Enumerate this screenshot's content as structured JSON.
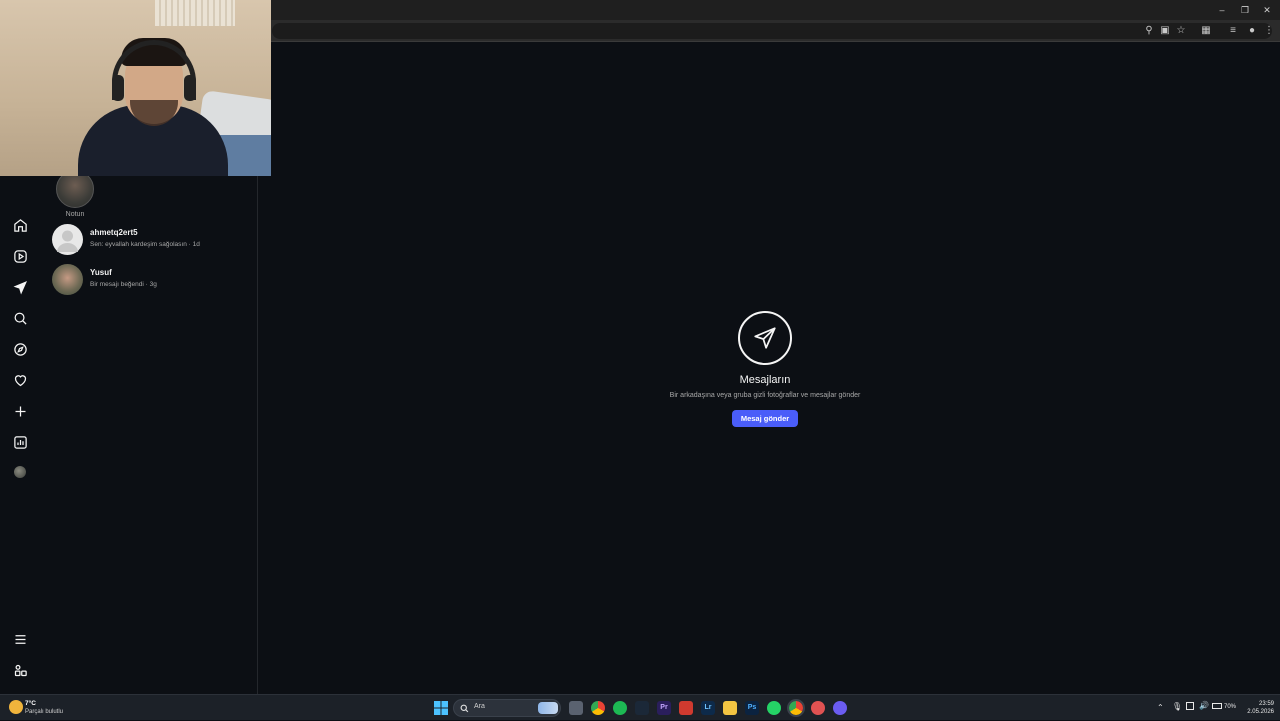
{
  "browser": {
    "window_controls": [
      "minimize-icon",
      "restore-icon",
      "close-icon"
    ],
    "toolbar_icons": [
      "zoom-icon",
      "install-icon",
      "star-icon",
      "extensions-icon",
      "media-icon",
      "profile-icon",
      "menu-icon"
    ]
  },
  "inbox": {
    "note_label": "Notun",
    "conversations": [
      {
        "name": "ahmetq2ert5",
        "preview": "Sen: eyvallah kardeşim sağolasın · 1d"
      },
      {
        "name": "Yusuf",
        "preview": "Bir mesajı beğendi · 3g"
      }
    ]
  },
  "nav": {
    "items": [
      "home-icon",
      "reels-icon",
      "messages-icon",
      "search-icon",
      "explore-icon",
      "notifications-icon",
      "create-icon",
      "dashboard-icon",
      "profile-avatar",
      "more-icon",
      "also-from-meta-icon"
    ]
  },
  "empty_state": {
    "title": "Mesajların",
    "subtitle": "Bir arkadaşına veya gruba gizli fotoğraflar ve mesajlar gönder",
    "button": "Mesaj gönder",
    "accent": "#4a5df9"
  },
  "taskbar": {
    "weather_temp": "7°C",
    "weather_text": "Parçalı bulutlu",
    "search_placeholder": "Ara",
    "battery": "70%",
    "time": "23:59",
    "date": "2.05.2026"
  }
}
